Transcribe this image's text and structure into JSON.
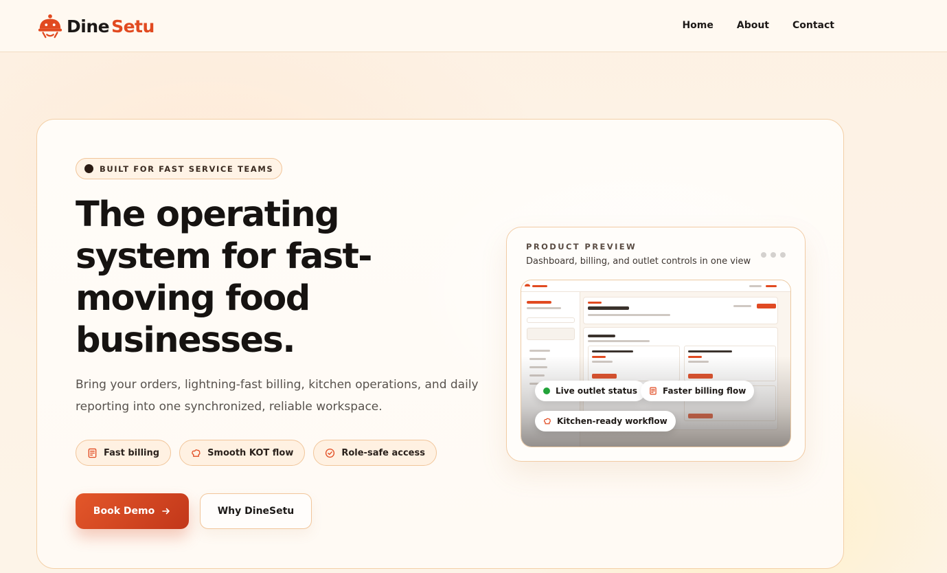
{
  "brand": {
    "name_part1": "Dine",
    "name_part2": "Setu",
    "accent": "#e14a20"
  },
  "nav": {
    "items": [
      {
        "label": "Home"
      },
      {
        "label": "About"
      },
      {
        "label": "Contact"
      }
    ]
  },
  "hero": {
    "badge": "BUILT FOR FAST SERVICE TEAMS",
    "headline": "The operating system for fast-moving food businesses.",
    "subtext": "Bring your orders, lightning-fast billing, kitchen operations, and daily reporting into one synchronized, reliable workspace.",
    "chips": [
      {
        "label": "Fast billing",
        "icon": "receipt-icon"
      },
      {
        "label": "Smooth KOT flow",
        "icon": "chef-hat-icon"
      },
      {
        "label": "Role-safe access",
        "icon": "check-badge-icon"
      }
    ],
    "cta_primary": "Book Demo",
    "cta_secondary": "Why DineSetu"
  },
  "preview": {
    "label": "PRODUCT PREVIEW",
    "subtitle": "Dashboard, billing, and outlet controls in one view",
    "tags": [
      {
        "label": "Live outlet status",
        "status_color": "#22a33a"
      },
      {
        "label": "Faster billing flow",
        "icon": "receipt-icon"
      },
      {
        "label": "Kitchen-ready workflow",
        "icon": "chef-hat-icon"
      }
    ]
  }
}
